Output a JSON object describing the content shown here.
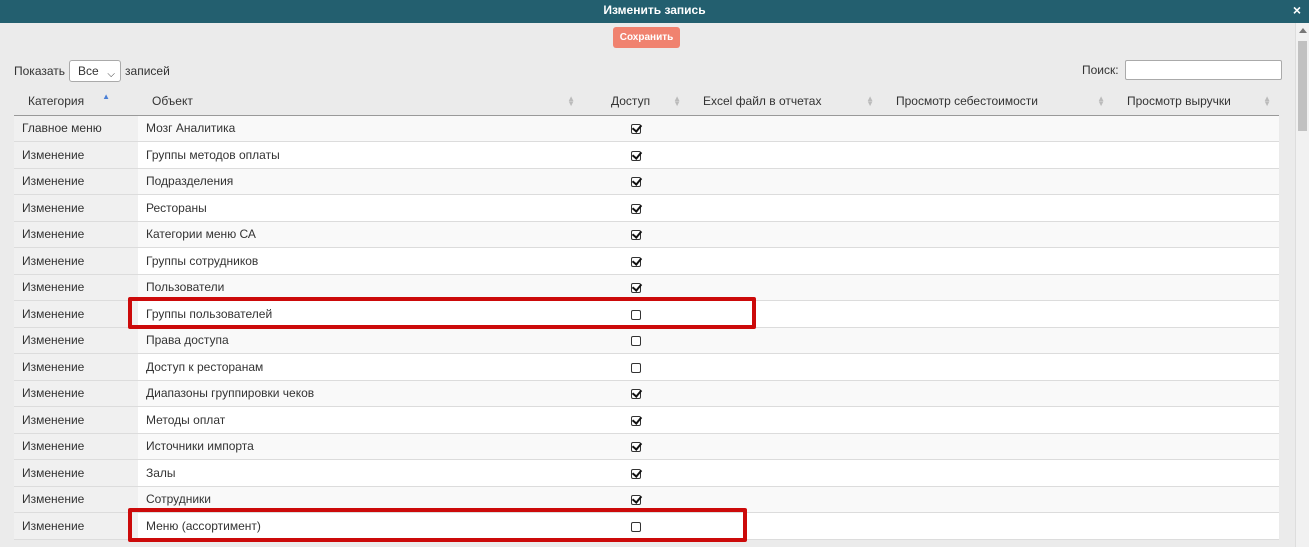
{
  "window": {
    "title": "Изменить запись",
    "close_label": "×"
  },
  "toolbar": {
    "save_label": "Сохранить"
  },
  "length": {
    "prefix": "Показать",
    "value": "Все",
    "suffix": "записей"
  },
  "search": {
    "label": "Поиск:",
    "value": "",
    "placeholder": ""
  },
  "columns": [
    "Категория",
    "Объект",
    "Доступ",
    "Excel файл в отчетах",
    "Просмотр себестоимости",
    "Просмотр выручки"
  ],
  "rows": [
    {
      "category": "Главное меню",
      "object": "Мозг Аналитика",
      "access": true
    },
    {
      "category": "Изменение",
      "object": "Группы методов оплаты",
      "access": true
    },
    {
      "category": "Изменение",
      "object": "Подразделения",
      "access": true
    },
    {
      "category": "Изменение",
      "object": "Рестораны",
      "access": true
    },
    {
      "category": "Изменение",
      "object": "Категории меню СА",
      "access": true
    },
    {
      "category": "Изменение",
      "object": "Группы сотрудников",
      "access": true
    },
    {
      "category": "Изменение",
      "object": "Пользователи",
      "access": true
    },
    {
      "category": "Изменение",
      "object": "Группы пользователей",
      "access": false
    },
    {
      "category": "Изменение",
      "object": "Права доступа",
      "access": false
    },
    {
      "category": "Изменение",
      "object": "Доступ к ресторанам",
      "access": false
    },
    {
      "category": "Изменение",
      "object": "Диапазоны группировки чеков",
      "access": true
    },
    {
      "category": "Изменение",
      "object": "Методы оплат",
      "access": true
    },
    {
      "category": "Изменение",
      "object": "Источники импорта",
      "access": true
    },
    {
      "category": "Изменение",
      "object": "Залы",
      "access": true
    },
    {
      "category": "Изменение",
      "object": "Сотрудники",
      "access": true
    },
    {
      "category": "Изменение",
      "object": "Меню (ассортимент)",
      "access": false
    }
  ],
  "colors": {
    "titlebar": "#235f6f",
    "save_button": "#f0826f",
    "highlight": "#cc0a0a"
  }
}
